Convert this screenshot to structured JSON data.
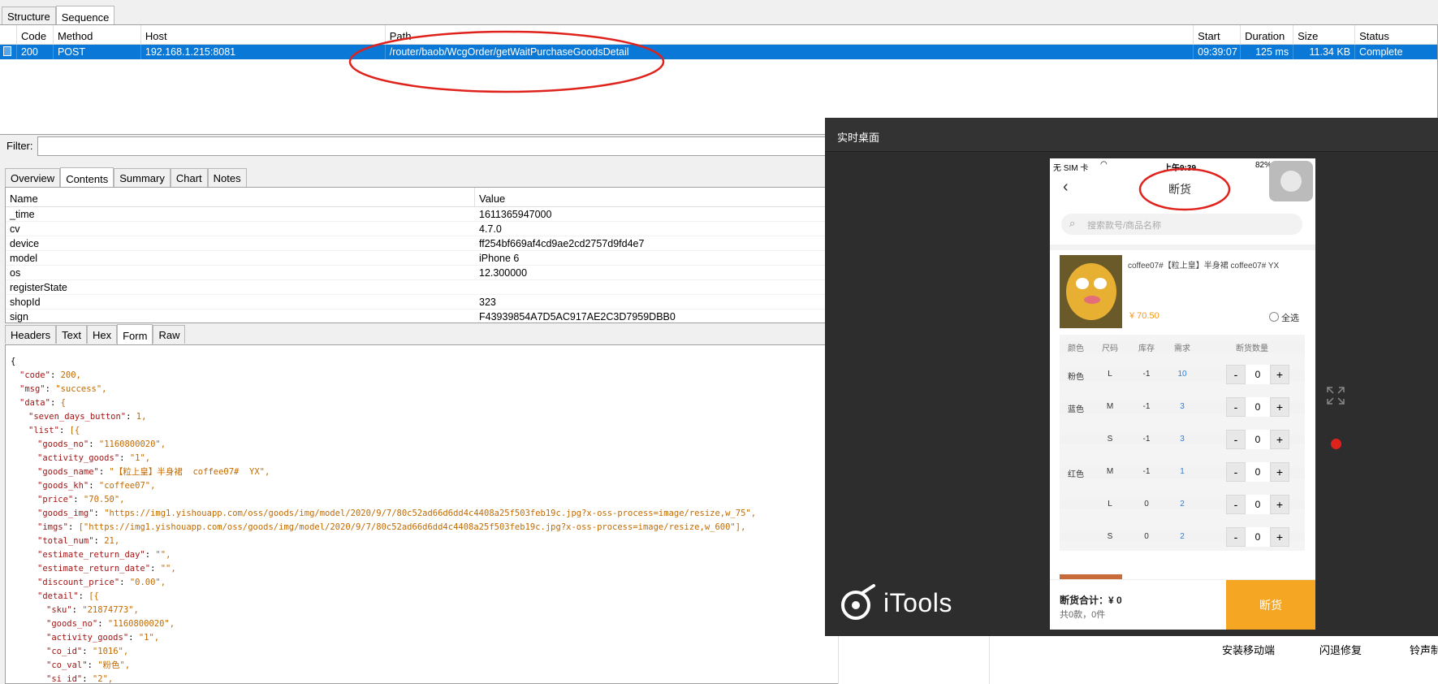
{
  "top_tabs": [
    {
      "label": "Structure"
    },
    {
      "label": "Sequence"
    }
  ],
  "session_columns": [
    "Code",
    "Method",
    "Host",
    "Path",
    "Start",
    "Duration",
    "Size",
    "Status"
  ],
  "session_row": {
    "code": "200",
    "method": "POST",
    "host": "192.168.1.215:8081",
    "path": "/router/baob/WcgOrder/getWaitPurchaseGoodsDetail",
    "start": "09:39:07",
    "duration": "125 ms",
    "size": "11.34 KB",
    "status": "Complete"
  },
  "filter": {
    "label": "Filter:",
    "value": ""
  },
  "detail_tabs": [
    {
      "label": "Overview"
    },
    {
      "label": "Contents"
    },
    {
      "label": "Summary"
    },
    {
      "label": "Chart"
    },
    {
      "label": "Notes"
    }
  ],
  "form_columns": [
    "Name",
    "Value"
  ],
  "form_rows": [
    {
      "name": "_time",
      "value": "1611365947000"
    },
    {
      "name": "cv",
      "value": "4.7.0"
    },
    {
      "name": "device",
      "value": "ff254bf669af4cd9ae2cd2757d9fd4e7"
    },
    {
      "name": "model",
      "value": "iPhone 6"
    },
    {
      "name": "os",
      "value": "12.300000"
    },
    {
      "name": "registerState",
      "value": ""
    },
    {
      "name": "shopId",
      "value": "323"
    },
    {
      "name": "sign",
      "value": "F43939854A7D5AC917AE2C3D7959DBB0"
    }
  ],
  "response_tabs": [
    {
      "label": "Headers"
    },
    {
      "label": "Text"
    },
    {
      "label": "Hex"
    },
    {
      "label": "Form"
    },
    {
      "label": "Raw"
    }
  ],
  "json_lines": [
    [
      "0",
      "{",
      "",
      ""
    ],
    [
      "1",
      "\"code\"",
      ": ",
      "200,"
    ],
    [
      "1",
      "\"msg\"",
      ": ",
      "\"success\","
    ],
    [
      "1",
      "\"data\"",
      ": ",
      "{"
    ],
    [
      "2",
      "\"seven_days_button\"",
      ": ",
      "1,"
    ],
    [
      "2",
      "\"list\"",
      ": ",
      "[{"
    ],
    [
      "3",
      "\"goods_no\"",
      ": ",
      "\"1160800020\","
    ],
    [
      "3",
      "\"activity_goods\"",
      ": ",
      "\"1\","
    ],
    [
      "3",
      "\"goods_name\"",
      ": ",
      "\"【粒上皇】半身裙  coffee07#  YX\","
    ],
    [
      "3",
      "\"goods_kh\"",
      ": ",
      "\"coffee07\","
    ],
    [
      "3",
      "\"price\"",
      ": ",
      "\"70.50\","
    ],
    [
      "3",
      "\"goods_img\"",
      ": ",
      "\"https://img1.yishouapp.com/oss/goods/img/model/2020/9/7/80c52ad66d6dd4c4408a25f503feb19c.jpg?x-oss-process=image/resize,w_75\","
    ],
    [
      "3",
      "\"imgs\"",
      ": ",
      "[\"https://img1.yishouapp.com/oss/goods/img/model/2020/9/7/80c52ad66d6dd4c4408a25f503feb19c.jpg?x-oss-process=image/resize,w_600\"],"
    ],
    [
      "3",
      "\"total_num\"",
      ": ",
      "21,"
    ],
    [
      "3",
      "\"estimate_return_day\"",
      ": ",
      "\"\","
    ],
    [
      "3",
      "\"estimate_return_date\"",
      ": ",
      "\"\","
    ],
    [
      "3",
      "\"discount_price\"",
      ": ",
      "\"0.00\","
    ],
    [
      "3",
      "\"detail\"",
      ": ",
      "[{"
    ],
    [
      "4",
      "\"sku\"",
      ": ",
      "\"21874773\","
    ],
    [
      "4",
      "\"goods_no\"",
      ": ",
      "\"1160800020\","
    ],
    [
      "4",
      "\"activity_goods\"",
      ": ",
      "\"1\","
    ],
    [
      "4",
      "\"co_id\"",
      ": ",
      "\"1016\","
    ],
    [
      "4",
      "\"co_val\"",
      ": ",
      "\"粉色\","
    ],
    [
      "4",
      "\"si_id\"",
      ": ",
      "\"2\","
    ]
  ],
  "itools": {
    "title": "实时桌面",
    "logo_text": "iTools"
  },
  "phone": {
    "status_left": "无 SIM 卡",
    "status_time": "上午9:39",
    "status_battery": "82%",
    "nav_title": "断货",
    "search_placeholder": "搜索款号/商品名称",
    "product_name": "coffee07#【粒上皇】半身裙  coffee07#  YX",
    "price": "¥ 70.50",
    "select_all": "全选",
    "grid_headers": [
      "颜色",
      "尺码",
      "库存",
      "需求",
      "断货数量"
    ],
    "grid_rows": [
      {
        "color": "粉色",
        "size": "L",
        "stock": "-1",
        "demand": "10",
        "qty": "0"
      },
      {
        "color": "蓝色",
        "size": "M",
        "stock": "-1",
        "demand": "3",
        "qty": "0"
      },
      {
        "color": "",
        "size": "S",
        "stock": "-1",
        "demand": "3",
        "qty": "0"
      },
      {
        "color": "红色",
        "size": "M",
        "stock": "-1",
        "demand": "1",
        "qty": "0"
      },
      {
        "color": "",
        "size": "L",
        "stock": "0",
        "demand": "2",
        "qty": "0"
      },
      {
        "color": "",
        "size": "S",
        "stock": "0",
        "demand": "2",
        "qty": "0"
      }
    ],
    "minus": "-",
    "plus": "+",
    "footer_total": "断货合计：¥ 0",
    "footer_count": "共0款，0件",
    "footer_button": "断货"
  },
  "bg_texts": [
    "安装移动端",
    "闪退修复",
    "铃声制"
  ],
  "colors": {
    "selection": "#0a78d7",
    "annotation": "#e0221c",
    "accent": "#f5a623",
    "demand": "#2f7fd8"
  }
}
